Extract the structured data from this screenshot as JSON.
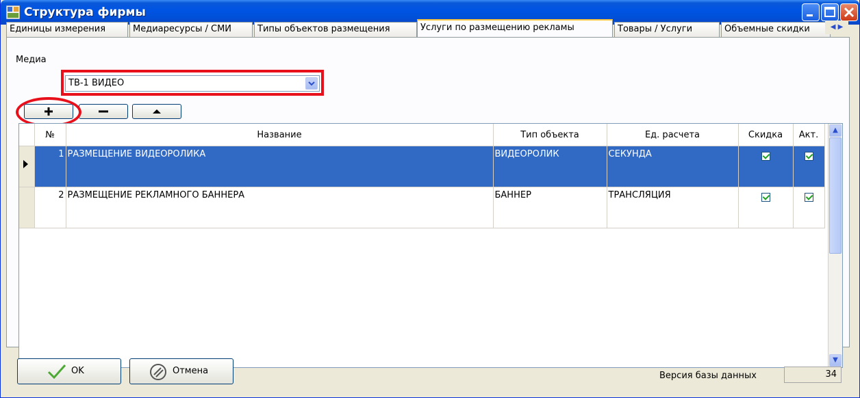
{
  "window": {
    "title": "Структура фирмы",
    "colors": {
      "title_bar": "#0054e3",
      "selection": "#316ac5",
      "highlight": "#e8101a",
      "tab_accent": "#ffc83c"
    }
  },
  "tabs": [
    {
      "label": "Единицы измерения",
      "active": false
    },
    {
      "label": "Медиаресурсы / СМИ",
      "active": false
    },
    {
      "label": "Типы объектов размещения",
      "active": false
    },
    {
      "label": "Услуги по размещению рекламы",
      "active": true
    },
    {
      "label": "Товары / Услуги",
      "active": false
    },
    {
      "label": "Объемные скидки",
      "active": false
    }
  ],
  "media": {
    "label": "Медиа",
    "value": "ТВ-1 ВИДЕО"
  },
  "toolbar": {
    "add_icon": "plus-icon",
    "remove_icon": "minus-icon",
    "up_icon": "arrow-up-icon"
  },
  "grid": {
    "columns": [
      "№",
      "Название",
      "Тип объекта",
      "Ед. расчета",
      "Скидка",
      "Акт."
    ],
    "rows": [
      {
        "num": "1",
        "name": "РАЗМЕЩЕНИЕ ВИДЕОРОЛИКА",
        "type": "ВИДЕОРОЛИК",
        "unit": "СЕКУНДА",
        "discount": true,
        "active": true,
        "selected": true
      },
      {
        "num": "2",
        "name": "РАЗМЕЩЕНИЕ РЕКЛАМНОГО БАННЕРА",
        "type": "БАННЕР",
        "unit": "ТРАНСЛЯЦИЯ",
        "discount": true,
        "active": true,
        "selected": false
      }
    ]
  },
  "footer": {
    "ok_label": "OK",
    "cancel_label": "Отмена",
    "db_version_label": "Версия базы данных",
    "db_version": "34"
  }
}
